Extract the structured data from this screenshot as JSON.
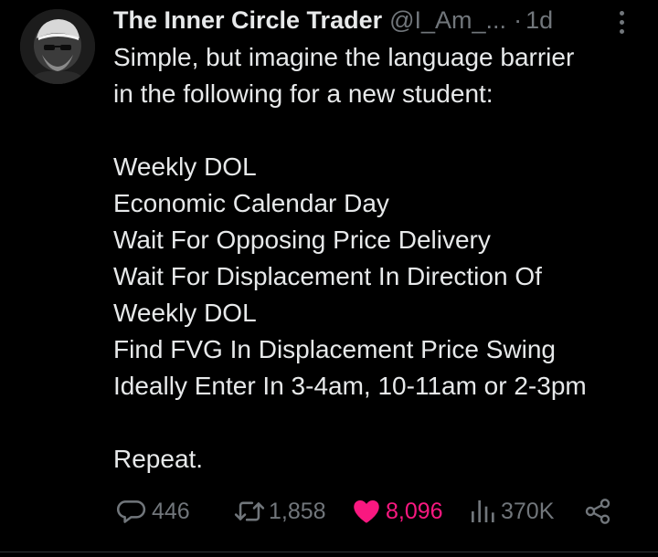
{
  "author": {
    "name": "The Inner Circle Trader",
    "handle": "@I_Am_...",
    "separator": "·",
    "time": "1d"
  },
  "tweet": {
    "lines": [
      "Simple, but imagine the language barrier",
      "in the following for a new student:",
      "",
      "Weekly DOL",
      "Economic Calendar Day",
      "Wait For Opposing Price Delivery",
      "Wait For Displacement In Direction Of",
      "Weekly DOL",
      "Find FVG In Displacement Price Swing",
      "Ideally Enter In 3-4am, 10-11am or 2-3pm",
      "",
      "Repeat."
    ]
  },
  "actions": {
    "replies": "446",
    "reposts": "1,858",
    "likes": "8,096",
    "views": "370K"
  },
  "icons": {
    "more": "more-vertical-icon",
    "reply": "reply-bubble-icon",
    "repost": "repost-icon",
    "like": "heart-icon",
    "views": "views-bars-icon",
    "share": "share-icon"
  },
  "colors": {
    "background": "#000000",
    "text": "#e7e9ea",
    "muted": "#71767b",
    "like": "#f91880"
  }
}
